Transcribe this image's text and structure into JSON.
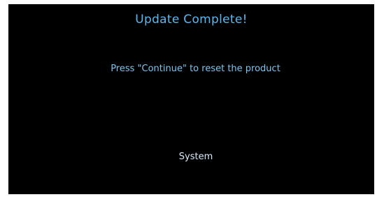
{
  "screen": {
    "title": "Update Complete!",
    "message": "Press \"Continue\" to reset the product",
    "system_label": "System"
  },
  "colors": {
    "background": "#000000",
    "title_text": "#5bb8ee",
    "message_text": "#7cc6f2",
    "system_text": "#d6ecfb"
  }
}
